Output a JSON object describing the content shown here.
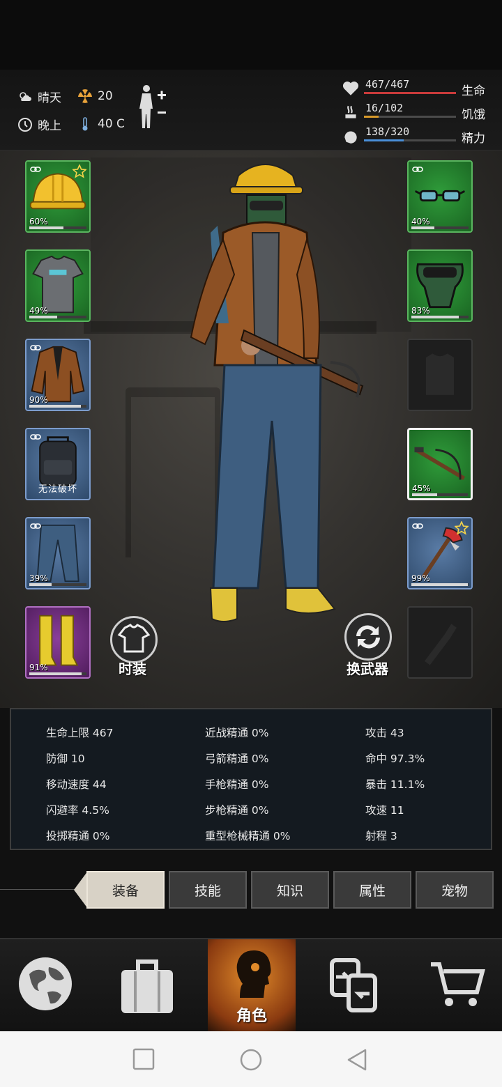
{
  "hud": {
    "weather": "晴天",
    "radiation": "20",
    "time_of_day": "晚上",
    "temperature": "40 C",
    "stats": [
      {
        "label": "生命",
        "value": "467/467",
        "current": 467,
        "max": 467,
        "color": "#c83a3a",
        "icon": "heart-icon"
      },
      {
        "label": "饥饿",
        "value": "16/102",
        "current": 16,
        "max": 102,
        "color": "#d89a2a",
        "icon": "hunger-icon"
      },
      {
        "label": "精力",
        "value": "138/320",
        "current": 138,
        "max": 320,
        "color": "#4a8fd8",
        "icon": "energy-icon"
      }
    ]
  },
  "equipment": {
    "left": [
      {
        "name": "helmet",
        "percent": "60%",
        "durability": 0.6,
        "rarity": "green",
        "linked": true,
        "starred": true
      },
      {
        "name": "tshirt",
        "percent": "49%",
        "durability": 0.49,
        "rarity": "green",
        "linked": false,
        "starred": false
      },
      {
        "name": "jacket",
        "percent": "90%",
        "durability": 0.9,
        "rarity": "blue",
        "linked": true,
        "starred": false
      },
      {
        "name": "backpack",
        "percent": "",
        "durability": 1,
        "rarity": "blue",
        "linked": true,
        "starred": false,
        "note": "无法破坏"
      },
      {
        "name": "jeans",
        "percent": "39%",
        "durability": 0.39,
        "rarity": "blue",
        "linked": true,
        "starred": false
      },
      {
        "name": "boots",
        "percent": "91%",
        "durability": 0.91,
        "rarity": "purple",
        "linked": false,
        "starred": false
      }
    ],
    "right": [
      {
        "name": "glasses",
        "percent": "40%",
        "durability": 0.4,
        "rarity": "green",
        "linked": true,
        "starred": false
      },
      {
        "name": "gas-mask",
        "percent": "83%",
        "durability": 0.83,
        "rarity": "green",
        "linked": false,
        "starred": false
      },
      {
        "name": "vest-empty",
        "percent": "",
        "durability": 0,
        "rarity": "empty",
        "linked": false,
        "starred": false
      },
      {
        "name": "crossbow",
        "percent": "45%",
        "durability": 0.45,
        "rarity": "green",
        "linked": false,
        "starred": false,
        "selected": true
      },
      {
        "name": "axe",
        "percent": "99%",
        "durability": 0.99,
        "rarity": "blue",
        "linked": true,
        "starred": true
      },
      {
        "name": "throwable-empty",
        "percent": "",
        "durability": 0,
        "rarity": "empty",
        "linked": false,
        "starred": false
      }
    ]
  },
  "buttons": {
    "outfit": "时装",
    "swap_weapon": "换武器"
  },
  "attributes": [
    [
      "生命上限 467",
      "近战精通 0%",
      "攻击 43"
    ],
    [
      "防御 10",
      "弓箭精通 0%",
      "命中 97.3%"
    ],
    [
      "移动速度 44",
      "手枪精通 0%",
      "暴击 11.1%"
    ],
    [
      "闪避率 4.5%",
      "步枪精通 0%",
      "攻速 11"
    ],
    [
      "投掷精通 0%",
      "重型枪械精通 0%",
      "射程 3"
    ]
  ],
  "tabs": [
    "装备",
    "技能",
    "知识",
    "属性",
    "宠物"
  ],
  "active_tab": 0,
  "nav": {
    "active_label": "角色",
    "items": [
      "map-icon",
      "backpack-icon",
      "character-icon",
      "trade-icon",
      "cart-icon"
    ]
  }
}
